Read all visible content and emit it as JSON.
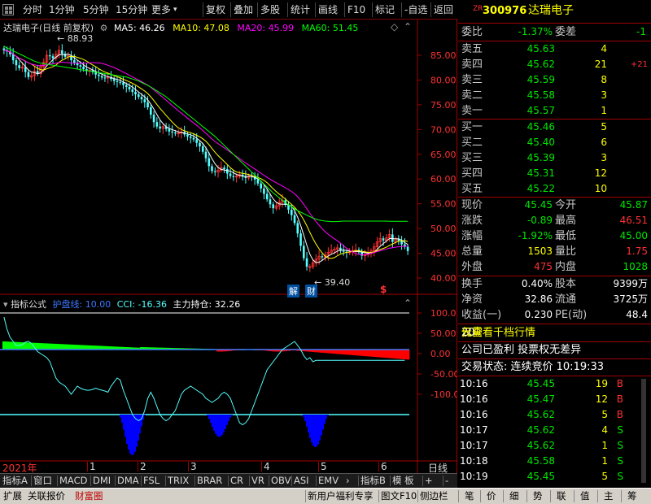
{
  "toolbar": {
    "left": [
      {
        "label": "分时",
        "name": "tb-intraday"
      },
      {
        "label": "1分钟",
        "name": "tb-1min"
      },
      {
        "label": "5分钟",
        "name": "tb-5min"
      },
      {
        "label": "15分钟",
        "name": "tb-15min"
      },
      {
        "label": "更多",
        "name": "tb-more"
      }
    ],
    "right": [
      {
        "label": "复权",
        "name": "tb-adjust"
      },
      {
        "label": "叠加",
        "name": "tb-overlay"
      },
      {
        "label": "多股",
        "name": "tb-multi"
      },
      {
        "label": "统计",
        "name": "tb-stats"
      },
      {
        "label": "画线",
        "name": "tb-draw"
      },
      {
        "label": "F10",
        "name": "tb-f10"
      },
      {
        "label": "标记",
        "name": "tb-mark"
      },
      {
        "label": "-自选",
        "name": "tb-remove-watch"
      },
      {
        "label": "返回",
        "name": "tb-back"
      }
    ]
  },
  "legend": {
    "title": "达瑞电子(日线 前复权)",
    "ma5": "MA5: 46.26",
    "ma10": "MA10: 47.08",
    "ma20": "MA20: 45.99",
    "ma60": "MA60: 51.45",
    "indicator_name": "指标公式",
    "zone": "护盘线: 10.00",
    "cci": "CCI: -16.36",
    "main": "主力持仓: 32.26"
  },
  "colors": {
    "ma5": "#ffffff",
    "ma10": "#ffff00",
    "ma20": "#ff00ff",
    "ma60": "#00ff00",
    "up": "#ff3232",
    "down": "#54ffff",
    "accent_red": "#a00000"
  },
  "annotations": {
    "high": "88.93",
    "low": "39.40",
    "jie": "解",
    "cai": "财",
    "dollar": "$"
  },
  "time_axis": {
    "year": "2021年",
    "months": [
      "1",
      "2",
      "3",
      "4",
      "5",
      "6"
    ],
    "right_label": "日线"
  },
  "chart_data": {
    "type": "candlestick",
    "price_axis": {
      "ticks": [
        85,
        80,
        75,
        70,
        65,
        60,
        55,
        50,
        45,
        40
      ],
      "labels": [
        "85.00",
        "80.00",
        "75.00",
        "70.00",
        "65.00",
        "60.00",
        "55.00",
        "50.00",
        "45.00",
        "40.00"
      ]
    },
    "indicator_axis": {
      "ticks": [
        100,
        50,
        0,
        -50,
        -100
      ],
      "labels": [
        "100.0",
        "50.00",
        "0.00",
        "-50.00",
        "-100.0"
      ],
      "ylim": [
        -260,
        110
      ]
    },
    "close": [
      86.0,
      85.8,
      85.2,
      84.0,
      83.0,
      82.4,
      82.6,
      81.6,
      80.6,
      80.9,
      81.8,
      81.3,
      82.7,
      83.6,
      85.0,
      84.8,
      84.4,
      85.2,
      86.0,
      85.3,
      84.7,
      84.9,
      84.0,
      83.5,
      83.0,
      82.7,
      82.2,
      81.8,
      82.0,
      81.6,
      81.1,
      80.8,
      80.5,
      80.4,
      80.6,
      80.2,
      79.8,
      79.6,
      79.5,
      79.0,
      78.6,
      78.1,
      77.6,
      77.1,
      76.6,
      76.1,
      75.5,
      74.5,
      73.0,
      71.5,
      70.6,
      70.2,
      70.6,
      70.1,
      69.6,
      69.4,
      69.2,
      69.3,
      69.5,
      69.0,
      68.6,
      68.3,
      68.0,
      67.3,
      66.6,
      65.5,
      64.2,
      62.6,
      61.6,
      61.4,
      61.8,
      62.3,
      62.0,
      61.1,
      60.6,
      60.4,
      60.6,
      60.9,
      60.5,
      60.2,
      60.6,
      60.4,
      59.9,
      59.1,
      58.1,
      57.0,
      55.9,
      54.9,
      54.1,
      54.6,
      55.3,
      55.7,
      54.8,
      53.8,
      52.7,
      51.1,
      49.0,
      46.5,
      44.0,
      42.3,
      42.3,
      43.1,
      43.8,
      44.4,
      44.2,
      44.6,
      45.2,
      45.6,
      45.8,
      46.1,
      45.5,
      45.3,
      45.1,
      45.3,
      45.5,
      45.7,
      45.2,
      44.5,
      44.7,
      45.0,
      45.5,
      46.3,
      47.3,
      48.0,
      47.6,
      48.1,
      48.8,
      47.3,
      47.9,
      47.5,
      46.8,
      46.3,
      45.45
    ],
    "ma60": [
      86.8,
      86.5,
      86.2,
      85.9,
      85.6,
      85.3,
      85.0,
      84.7,
      84.4,
      84.1,
      83.8,
      83.6,
      83.4,
      83.3,
      83.2,
      83.1,
      83.0,
      82.9,
      82.8,
      82.7,
      82.6,
      82.5,
      82.4,
      82.3,
      82.2,
      82.1,
      82.0,
      81.9,
      81.8,
      81.7,
      81.6,
      81.5,
      81.4,
      81.3,
      81.2,
      81.1,
      81.0,
      80.9,
      80.8,
      80.7,
      80.6,
      80.4,
      80.2,
      80.0,
      79.8,
      79.5,
      79.2,
      78.9,
      78.6,
      78.2,
      77.8,
      77.4,
      77.0,
      76.6,
      76.1,
      75.6,
      75.1,
      74.6,
      74.1,
      73.6,
      73.1,
      72.6,
      72.1,
      71.6,
      71.1,
      70.6,
      70.1,
      69.6,
      69.1,
      68.6,
      68.0,
      67.4,
      66.8,
      66.2,
      65.6,
      65.0,
      64.4,
      63.8,
      63.2,
      62.6,
      62.0,
      61.4,
      60.8,
      60.2,
      59.6,
      59.0,
      58.4,
      57.8,
      57.2,
      56.7,
      56.2,
      55.7,
      55.2,
      54.8,
      54.4,
      54.0,
      53.6,
      53.3,
      53.0,
      52.7,
      52.4,
      52.1,
      51.9,
      51.7,
      51.6,
      51.5,
      51.45,
      51.4,
      51.4,
      51.4,
      51.45,
      51.5,
      51.5,
      51.5,
      51.5,
      51.5,
      51.5,
      51.5,
      51.5,
      51.5,
      51.5,
      51.5,
      51.5,
      51.5,
      51.5,
      51.5,
      51.45,
      51.45,
      51.45,
      51.45,
      51.45,
      51.45,
      51.45
    ],
    "cci": [
      90,
      60,
      40,
      30,
      20,
      20,
      22,
      28,
      30,
      25,
      15,
      5,
      0,
      -5,
      -10,
      -20,
      -40,
      -60,
      -70,
      -75,
      -80,
      -90,
      -100,
      -90,
      -80,
      -85,
      -88,
      -90,
      -90,
      -88,
      -85,
      -88,
      -90,
      -92,
      -95,
      -80,
      -70,
      -60,
      -65,
      -90,
      -110,
      -130,
      -150,
      -160,
      -165,
      -160,
      -140,
      -110,
      -95,
      -110,
      -130,
      -150,
      -160,
      -165,
      -160,
      -150,
      -140,
      -120,
      -100,
      -90,
      -85,
      -80,
      -85,
      -90,
      -95,
      -100,
      -110,
      -115,
      -120,
      -115,
      -110,
      -100,
      -95,
      -100,
      -110,
      -130,
      -150,
      -170,
      -175,
      -170,
      -160,
      -140,
      -120,
      -100,
      -80,
      -60,
      -40,
      -30,
      -20,
      -10,
      0,
      10,
      15,
      20,
      25,
      30,
      20,
      10,
      -5,
      -15,
      -10,
      -20,
      -16.36,
      -16.36,
      -16.36,
      -16.36,
      -16.36,
      -16.36,
      -16.36,
      -16.36,
      -16.36,
      -16.36,
      -16.36,
      -16.36,
      -16.36,
      -16.36,
      -16.36,
      -16.36,
      -16.36,
      -16.36,
      -16.36,
      -16.36,
      -16.36,
      -16.36,
      -16.36,
      -16.36,
      -16.36,
      -16.36,
      -16.36,
      -16.36,
      -16.36,
      -16.36
    ]
  },
  "quote": {
    "code": "300976",
    "name": "达瑞电子",
    "tag": "ZR",
    "weibi_label": "委比",
    "weibi": "-1.37%",
    "weicha_label": "委差",
    "weicha": "-1",
    "asks": [
      {
        "label": "卖五",
        "price": "45.63",
        "vol": "4",
        "chg": ""
      },
      {
        "label": "卖四",
        "price": "45.62",
        "vol": "21",
        "chg": "+21"
      },
      {
        "label": "卖三",
        "price": "45.59",
        "vol": "8",
        "chg": ""
      },
      {
        "label": "卖二",
        "price": "45.58",
        "vol": "3",
        "chg": ""
      },
      {
        "label": "卖一",
        "price": "45.57",
        "vol": "1",
        "chg": ""
      }
    ],
    "bids": [
      {
        "label": "买一",
        "price": "45.46",
        "vol": "5"
      },
      {
        "label": "买二",
        "price": "45.40",
        "vol": "6"
      },
      {
        "label": "买三",
        "price": "45.39",
        "vol": "3"
      },
      {
        "label": "买四",
        "price": "45.31",
        "vol": "12"
      },
      {
        "label": "买五",
        "price": "45.22",
        "vol": "10"
      }
    ],
    "stats": [
      {
        "l1": "现价",
        "v1": "45.45",
        "c1": "green",
        "l2": "今开",
        "v2": "45.87",
        "c2": "green"
      },
      {
        "l1": "涨跌",
        "v1": "-0.89",
        "c1": "green",
        "l2": "最高",
        "v2": "46.51",
        "c2": "red"
      },
      {
        "l1": "涨幅",
        "v1": "-1.92%",
        "c1": "green",
        "l2": "最低",
        "v2": "45.00",
        "c2": "green"
      },
      {
        "l1": "总量",
        "v1": "1503",
        "c1": "yellow",
        "l2": "量比",
        "v2": "1.75",
        "c2": "red"
      },
      {
        "l1": "外盘",
        "v1": "475",
        "c1": "red",
        "l2": "内盘",
        "v2": "1028",
        "c2": "green"
      }
    ],
    "fund": [
      {
        "l1": "换手",
        "v1": "0.40%",
        "l2": "股本",
        "v2": "9399万"
      },
      {
        "l1": "净资",
        "v1": "32.86",
        "l2": "流通",
        "v2": "3725万"
      },
      {
        "l1": "收益(一)",
        "v1": "0.230",
        "l2": "PE(动)",
        "v2": "48.4"
      }
    ],
    "promo_pre": "仅需",
    "promo_num": "20",
    "promo_post": "元查看千档行情",
    "company_note": "公司已盈利 投票权无差异",
    "trade_status": "交易状态: 连续竞价 10:19:33",
    "ticks": [
      {
        "time": "10:16",
        "price": "45.45",
        "vol": "19",
        "side": "B"
      },
      {
        "time": "10:16",
        "price": "45.47",
        "vol": "12",
        "side": "B"
      },
      {
        "time": "10:16",
        "price": "45.62",
        "vol": "5",
        "side": "B"
      },
      {
        "time": "10:17",
        "price": "45.62",
        "vol": "4",
        "side": "S"
      },
      {
        "time": "10:17",
        "price": "45.62",
        "vol": "1",
        "side": "S"
      },
      {
        "time": "10:18",
        "price": "45.58",
        "vol": "1",
        "side": "S"
      },
      {
        "time": "10:19",
        "price": "45.45",
        "vol": "5",
        "side": "S"
      }
    ]
  },
  "tabs": [
    "指标A",
    "窗口",
    "MACD",
    "DMI",
    "DMA",
    "FSL",
    "TRIX",
    "BRAR",
    "CR",
    "VR",
    "OBV",
    "ASI",
    "EMV",
    "指标B",
    "模 板",
    "+",
    "-"
  ],
  "statusbar": {
    "left": [
      "扩展",
      "关联报价",
      "财富圈"
    ],
    "mid": [
      "新用户福利专享",
      "图文F10",
      "侧边栏"
    ],
    "right": [
      "笔",
      "价",
      "细",
      "势",
      "联",
      "值",
      "主",
      "筹"
    ]
  }
}
